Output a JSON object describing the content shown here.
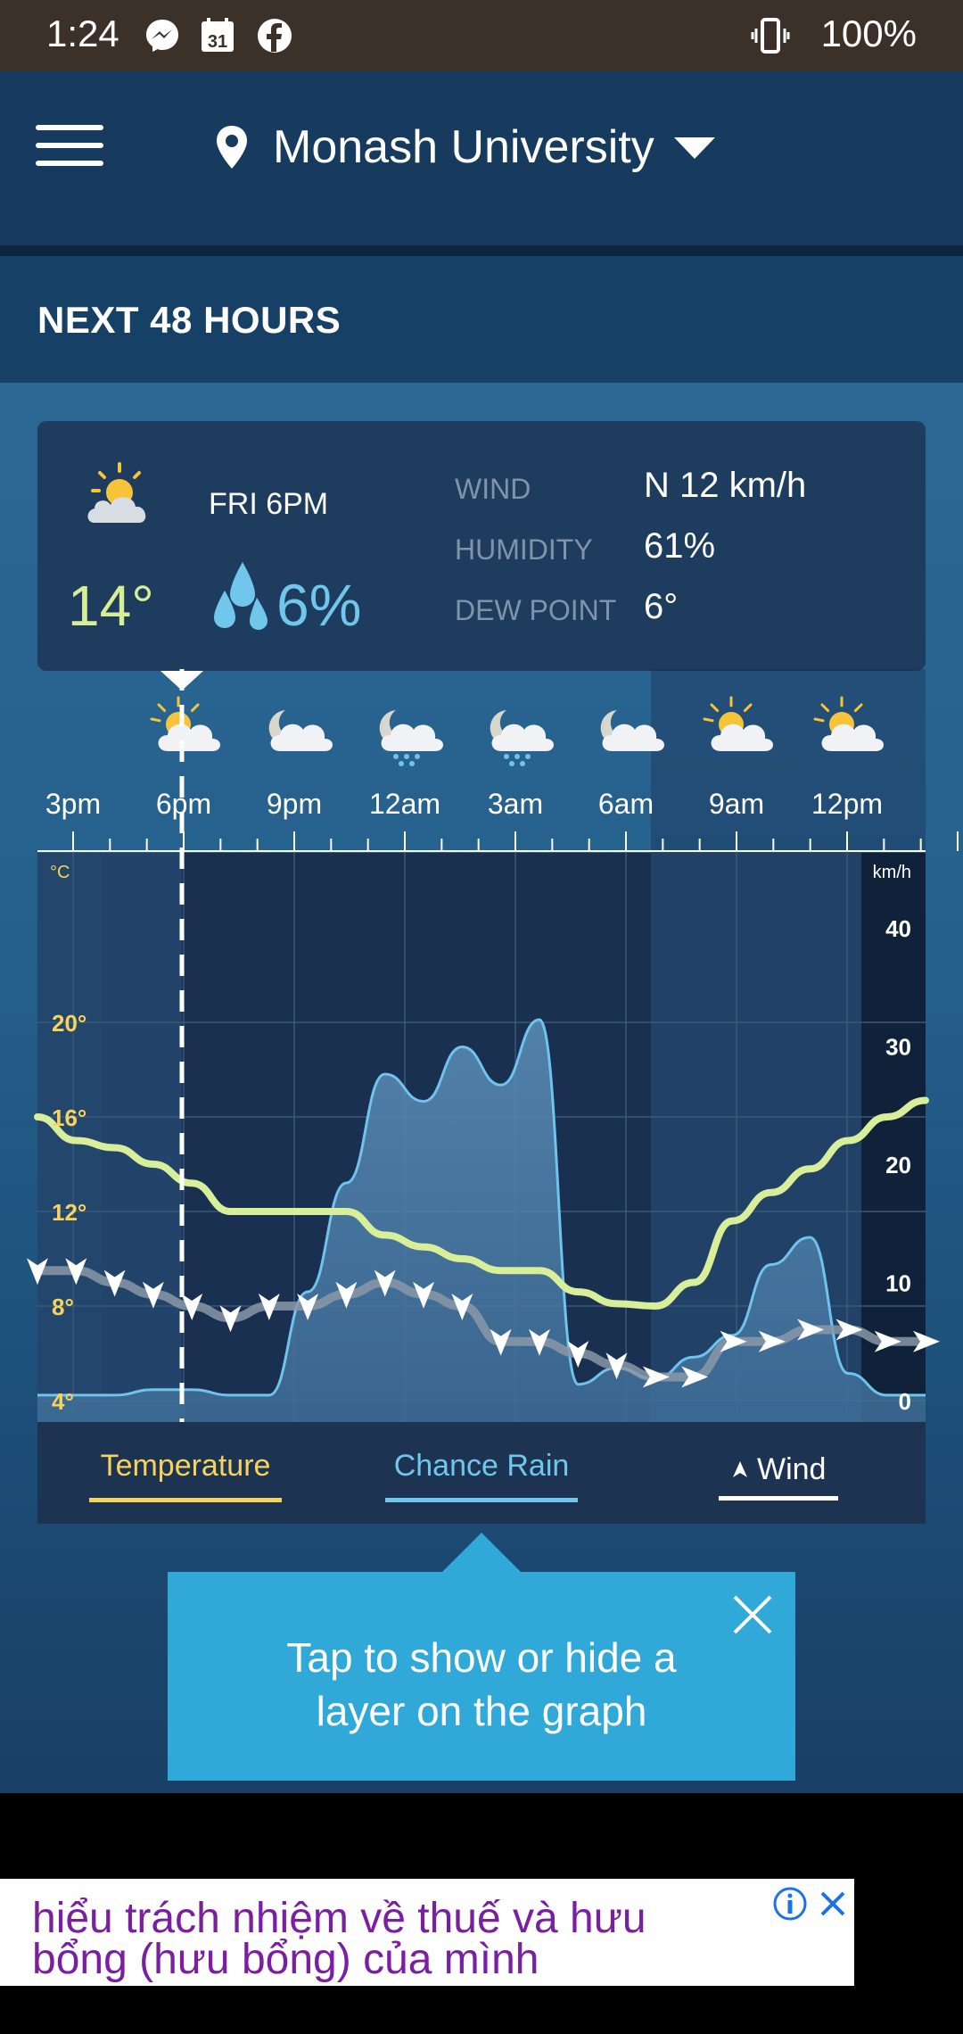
{
  "status_bar": {
    "time": "1:24",
    "calendar_day": "31",
    "battery": "100%"
  },
  "header": {
    "location": "Monash University"
  },
  "section": {
    "title": "NEXT 48 HOURS"
  },
  "current": {
    "time": "FRI 6PM",
    "temperature": "14°",
    "rain_chance": "6%",
    "wind_label": "WIND",
    "wind_value": "N 12 km/h",
    "humidity_label": "HUMIDITY",
    "humidity_value": "61%",
    "dew_label": "DEW POINT",
    "dew_value": "6°"
  },
  "timeline": {
    "labels": [
      "3pm",
      "6pm",
      "9pm",
      "12am",
      "3am",
      "6am",
      "9am",
      "12pm"
    ],
    "icons": [
      "partly-cloudy-day-icon",
      "cloudy-night-icon",
      "rain-night-icon",
      "rain-night-icon",
      "cloudy-night-icon",
      "partly-cloudy-day-icon",
      "partly-cloudy-day-icon"
    ]
  },
  "chart_data": {
    "type": "line",
    "x": [
      "3pm",
      "4pm",
      "5pm",
      "6pm",
      "7pm",
      "8pm",
      "9pm",
      "10pm",
      "11pm",
      "12am",
      "1am",
      "2am",
      "3am",
      "4am",
      "5am",
      "6am",
      "7am",
      "8am",
      "9am",
      "10am",
      "11am",
      "12pm",
      "1pm",
      "2pm"
    ],
    "series": [
      {
        "name": "Temperature",
        "unit": "°C",
        "color": "#d9ee98",
        "values": [
          16.0,
          15.0,
          14.7,
          14.0,
          13.2,
          12.0,
          12.0,
          12.0,
          12.0,
          11.0,
          10.5,
          10.0,
          9.5,
          9.5,
          8.6,
          8.1,
          8.0,
          9.0,
          11.6,
          12.8,
          13.8,
          15.0,
          16.0,
          16.7
        ]
      },
      {
        "name": "Chance Rain",
        "unit": "%",
        "color": "#6fc3ec",
        "values": [
          1,
          1,
          1,
          2,
          2,
          1,
          1,
          20,
          40,
          60,
          55,
          65,
          58,
          70,
          3,
          6,
          4,
          8,
          12,
          25,
          30,
          5,
          1,
          1
        ]
      },
      {
        "name": "Wind",
        "unit": "km/h",
        "color": "#ffffff",
        "values": [
          11,
          11,
          10,
          9,
          8,
          7,
          8,
          8,
          9,
          10,
          9,
          8,
          5,
          5,
          4,
          3,
          2,
          2,
          5,
          5,
          6,
          6,
          5,
          5
        ]
      }
    ],
    "y_left": {
      "unit": "°C",
      "ticks": [
        "20°",
        "16°",
        "12°",
        "8°",
        "4°"
      ],
      "range": [
        4,
        24
      ]
    },
    "y_right": {
      "unit": "km/h",
      "ticks": [
        "40",
        "30",
        "20",
        "10",
        "0"
      ],
      "range": [
        0,
        40
      ]
    },
    "grid": true
  },
  "legend": {
    "temperature": "Temperature",
    "rain": "Chance Rain",
    "wind": "Wind"
  },
  "tooltip": {
    "line1": "Tap to show or hide a",
    "line2": "layer on the graph"
  },
  "ad": {
    "line1": "hiểu trách nhiệm về thuế và hưu",
    "line2": "bổng (hưu bổng) của mình"
  },
  "colors": {
    "temperature": "#d9ee98",
    "rain": "#6fc3ec",
    "tooltip": "#30a9d8",
    "accent_yellow": "#f7d35b"
  }
}
